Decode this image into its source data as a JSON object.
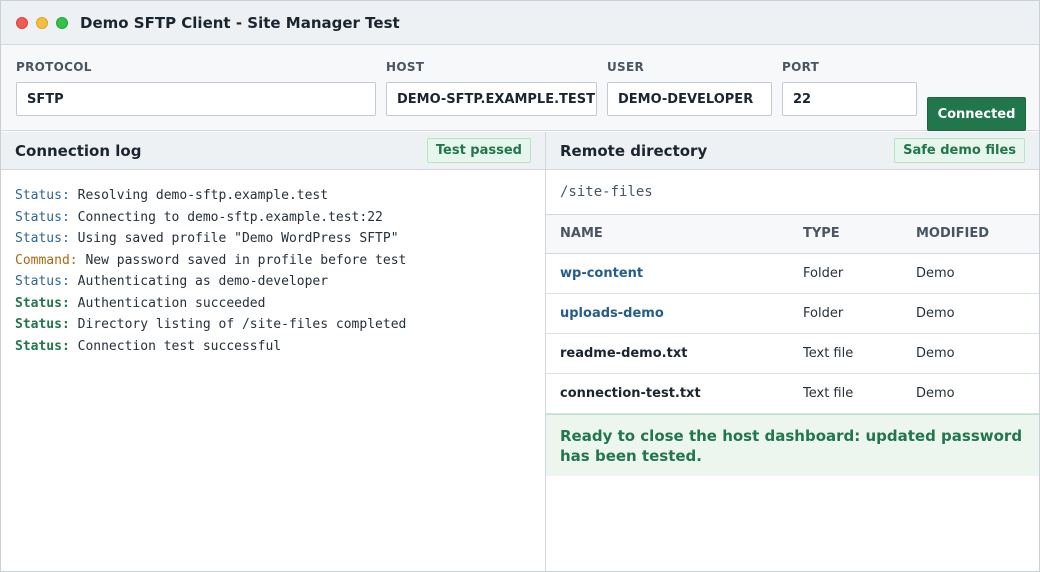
{
  "window": {
    "title": "Demo SFTP Client - Site Manager Test"
  },
  "connection": {
    "protocol_label": "PROTOCOL",
    "protocol_value": "SFTP",
    "host_label": "HOST",
    "host_value": "DEMO-SFTP.EXAMPLE.TEST",
    "user_label": "USER",
    "user_value": "DEMO-DEVELOPER",
    "port_label": "PORT",
    "port_value": "22",
    "connect_button": "Connected"
  },
  "log_pane": {
    "title": "Connection log",
    "badge": "Test passed",
    "lines": [
      {
        "tag": "Status:",
        "kind": "status",
        "text": " Resolving demo-sftp.example.test"
      },
      {
        "tag": "Status:",
        "kind": "status",
        "text": " Connecting to demo-sftp.example.test:22"
      },
      {
        "tag": "Status:",
        "kind": "status",
        "text": " Using saved profile \"Demo WordPress SFTP\""
      },
      {
        "tag": "Command:",
        "kind": "command",
        "text": " New password saved in profile before test"
      },
      {
        "tag": "Status:",
        "kind": "status",
        "text": " Authenticating as demo-developer"
      },
      {
        "tag": "Status:",
        "kind": "success",
        "text": " Authentication succeeded"
      },
      {
        "tag": "Status:",
        "kind": "success",
        "text": " Directory listing of /site-files completed"
      },
      {
        "tag": "Status:",
        "kind": "success",
        "text": " Connection test successful"
      }
    ]
  },
  "remote_pane": {
    "title": "Remote directory",
    "badge": "Safe demo files",
    "path": "/site-files",
    "columns": {
      "name": "NAME",
      "type": "TYPE",
      "modified": "MODIFIED"
    },
    "rows": [
      {
        "name": "wp-content",
        "type": "Folder",
        "modified": "Demo"
      },
      {
        "name": "uploads-demo",
        "type": "Folder",
        "modified": "Demo"
      },
      {
        "name": "readme-demo.txt",
        "type": "Text file",
        "modified": "Demo"
      },
      {
        "name": "connection-test.txt",
        "type": "Text file",
        "modified": "Demo"
      }
    ],
    "ready_message": "Ready to close the host dashboard: updated password has been tested."
  },
  "colors": {
    "accent_green": "#22764c",
    "link_blue": "#245d8c",
    "command_amber": "#a86a10",
    "status_blue": "#2c6694"
  }
}
